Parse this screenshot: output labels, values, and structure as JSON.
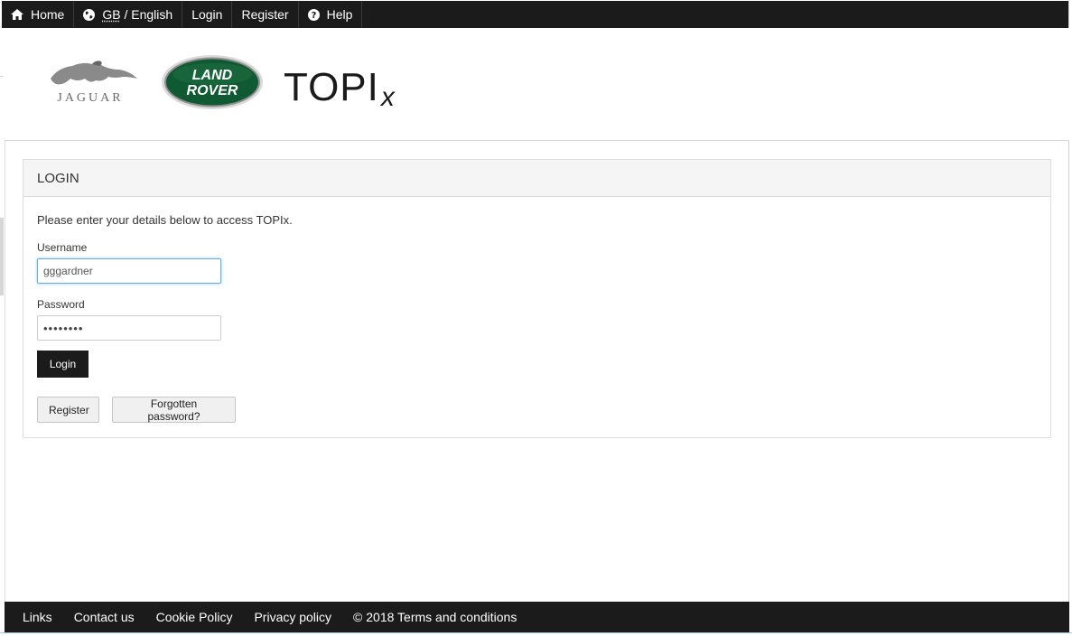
{
  "nav": {
    "home": "Home",
    "locale_region": "GB",
    "locale_sep": " / ",
    "locale_lang": "English",
    "login": "Login",
    "register": "Register",
    "help": "Help"
  },
  "logos": {
    "jaguar": "JAGUAR",
    "land_rover_line1": "LAND",
    "land_rover_line2": "ROVER",
    "topix_main": "TOPI",
    "topix_x": "x",
    "brand_green": "#0f5a32"
  },
  "login_panel": {
    "heading": "LOGIN",
    "intro": "Please enter your details below to access TOPIx.",
    "username_label": "Username",
    "username_value": "gggardner",
    "password_label": "Password",
    "password_value": "••••••••",
    "login_button": "Login",
    "register_button": "Register",
    "forgot_button": "Forgotten password?"
  },
  "footer": {
    "links": "Links",
    "contact": "Contact us",
    "cookie": "Cookie Policy",
    "privacy": "Privacy policy",
    "terms": "© 2018 Terms and conditions"
  }
}
